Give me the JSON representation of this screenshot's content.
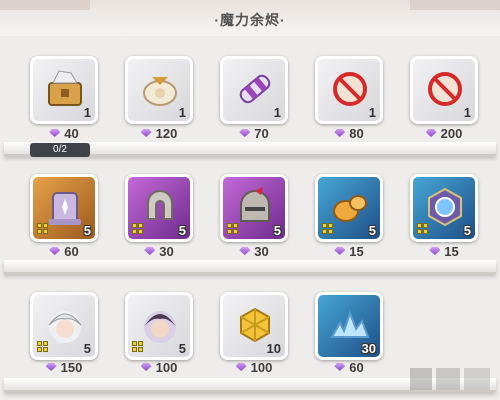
{
  "header": {
    "title": "·魔力余烬·"
  },
  "colors": {
    "gem": "#a05ad6",
    "rarity_gray": "#e4e4e8",
    "rarity_gold": "#c67a2c",
    "rarity_purple": "#9a45b8",
    "rarity_blue": "#2f78b0"
  },
  "rows": [
    {
      "items": [
        {
          "name": "treasure-chest-icon",
          "rarity": "gray",
          "count": "1",
          "price": "40",
          "fragment": false,
          "progress": "0/2",
          "progress_fraction": 0
        },
        {
          "name": "scroll-bundle-icon",
          "rarity": "gray",
          "count": "1",
          "price": "120",
          "fragment": false
        },
        {
          "name": "purple-scroll-icon",
          "rarity": "gray",
          "count": "1",
          "price": "70",
          "fragment": false
        },
        {
          "name": "sold-out-icon",
          "rarity": "gray",
          "count": "1",
          "price": "80",
          "fragment": false
        },
        {
          "name": "sold-out-icon",
          "rarity": "gray",
          "count": "1",
          "price": "200",
          "fragment": false
        }
      ]
    },
    {
      "items": [
        {
          "name": "stone-tablet-icon",
          "rarity": "gold",
          "count": "5",
          "price": "60",
          "fragment": true
        },
        {
          "name": "stone-horseshoe-icon",
          "rarity": "purple",
          "count": "5",
          "price": "30",
          "fragment": true
        },
        {
          "name": "knight-helmet-icon",
          "rarity": "purple",
          "count": "5",
          "price": "30",
          "fragment": true
        },
        {
          "name": "amber-shell-icon",
          "rarity": "blue",
          "count": "5",
          "price": "15",
          "fragment": true
        },
        {
          "name": "hexagon-emblem-icon",
          "rarity": "blue",
          "count": "5",
          "price": "15",
          "fragment": true
        }
      ]
    },
    {
      "items": [
        {
          "name": "white-hair-hero-portrait",
          "rarity": "gray",
          "count": "5",
          "price": "150",
          "fragment": true
        },
        {
          "name": "dark-hair-hero-portrait",
          "rarity": "gray",
          "count": "5",
          "price": "100",
          "fragment": true
        },
        {
          "name": "gold-cube-icon",
          "rarity": "gray",
          "count": "10",
          "price": "100",
          "fragment": false
        },
        {
          "name": "ice-crystal-icon",
          "rarity": "blue",
          "count": "30",
          "price": "60",
          "fragment": false
        }
      ]
    }
  ]
}
